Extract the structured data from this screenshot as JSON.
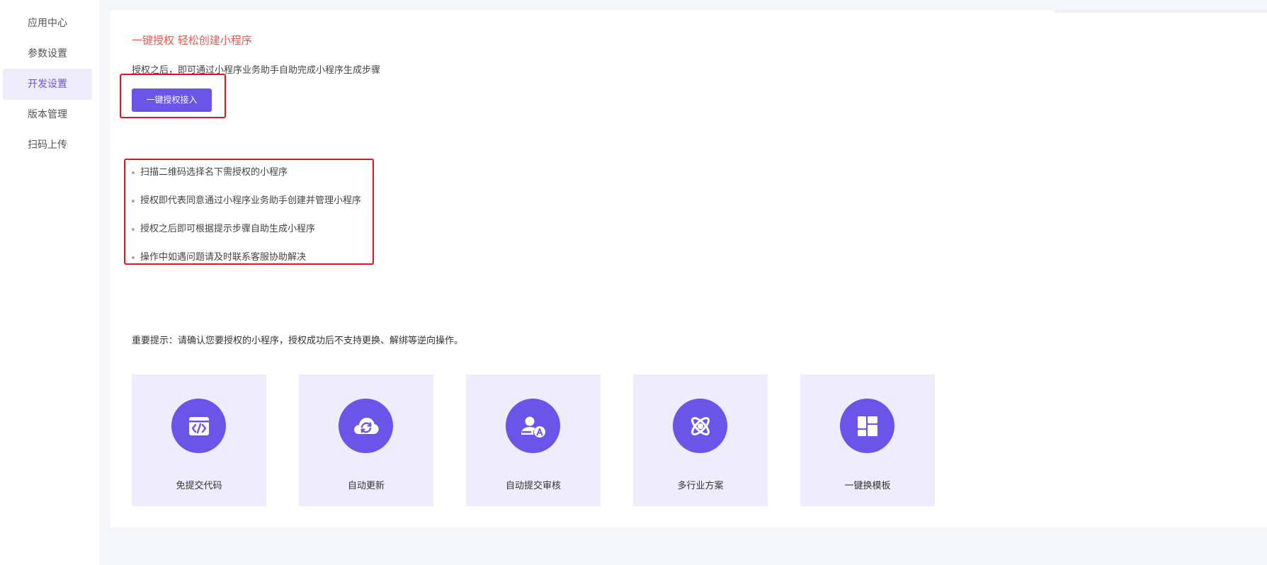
{
  "sidebar": {
    "items": [
      {
        "label": "应用中心",
        "active": false
      },
      {
        "label": "参数设置",
        "active": false
      },
      {
        "label": "开发设置",
        "active": true
      },
      {
        "label": "版本管理",
        "active": false
      },
      {
        "label": "扫码上传",
        "active": false
      }
    ]
  },
  "main": {
    "headline": "一键授权 轻松创建小程序",
    "subtitle": "授权之后，即可通过小程序业务助手自助完成小程序生成步骤",
    "auth_button_label": "一键授权接入",
    "bullets": [
      "扫描二维码选择名下需授权的小程序",
      "授权即代表同意通过小程序业务助手创建并管理小程序",
      "授权之后即可根据提示步骤自助生成小程序",
      "操作中如遇问题请及时联系客服协助解决"
    ],
    "notice": "重要提示：请确认您要授权的小程序，授权成功后不支持更换、解绑等逆向操作。",
    "features": [
      {
        "label": "免提交代码",
        "icon": "code-window-icon"
      },
      {
        "label": "自动更新",
        "icon": "cloud-sync-icon"
      },
      {
        "label": "自动提交审核",
        "icon": "user-audit-icon"
      },
      {
        "label": "多行业方案",
        "icon": "atom-icon"
      },
      {
        "label": "一键换模板",
        "icon": "template-layout-icon"
      }
    ]
  },
  "colors": {
    "accent": "#6a55e8",
    "accent_light": "#eeecfd",
    "headline": "#f2564f",
    "highlight_border": "#e8131f"
  }
}
